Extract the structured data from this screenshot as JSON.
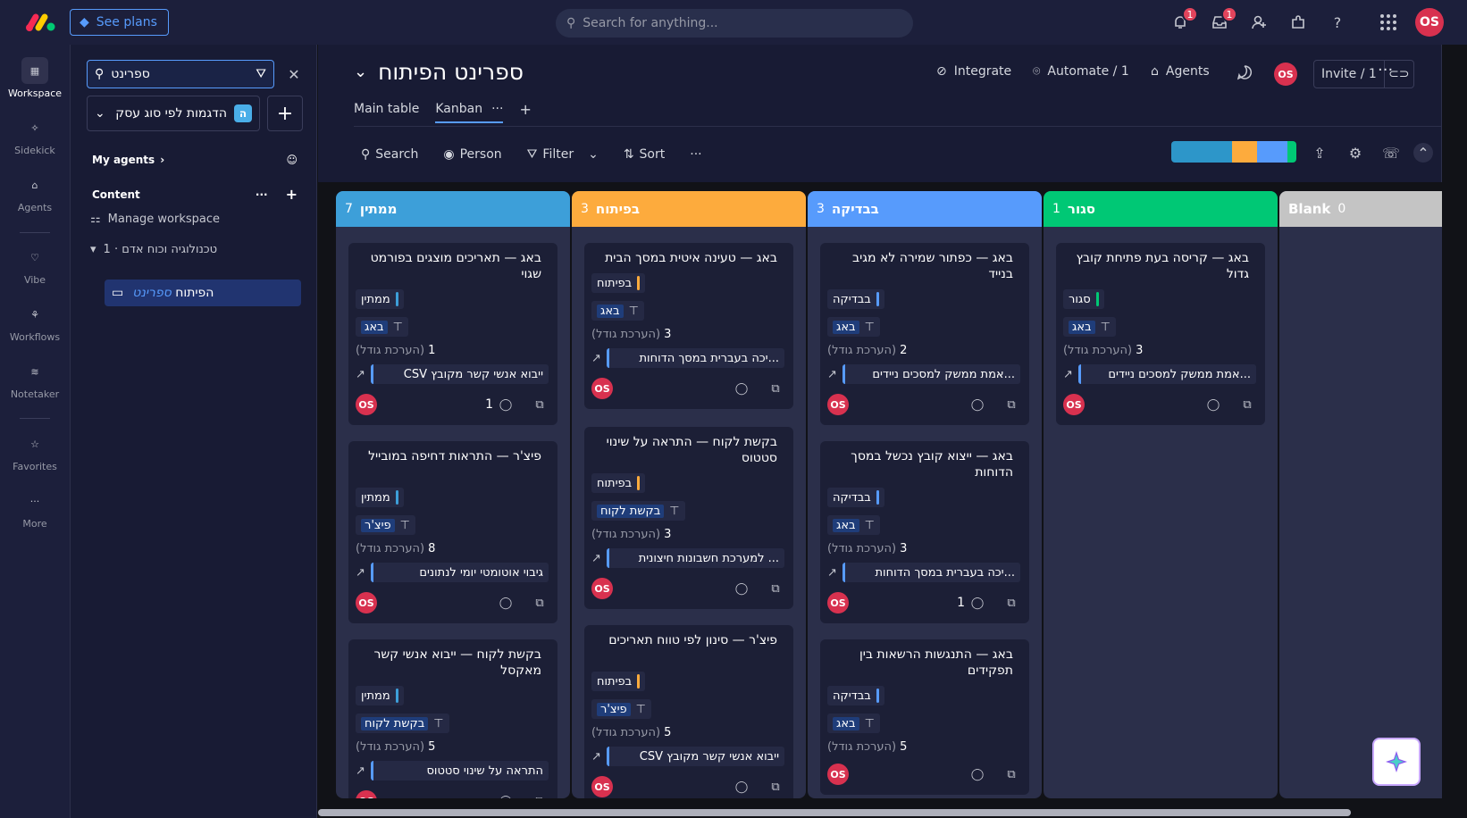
{
  "topbar": {
    "see_plans": "See plans",
    "search_placeholder": "Search for anything...",
    "notifications_badge": "1",
    "inbox_badge": "1",
    "avatar": "OS"
  },
  "rail": [
    {
      "label": "Workspace",
      "icon": "grid-icon"
    },
    {
      "label": "Sidekick",
      "icon": "sparkle-icon"
    },
    {
      "label": "Agents",
      "icon": "agents-icon"
    },
    {
      "label": "Vibe",
      "icon": "heart-icon"
    },
    {
      "label": "Workflows",
      "icon": "workflows-icon"
    },
    {
      "label": "Notetaker",
      "icon": "waveform-icon"
    },
    {
      "label": "Favorites",
      "icon": "star-icon"
    },
    {
      "label": "More",
      "icon": "more-icon"
    }
  ],
  "panel": {
    "search_value": "ספרינט",
    "workspace_chip": "ה",
    "workspace_name": "הדגמות לפי סוג עסק",
    "my_agents": "My agents",
    "content": "Content",
    "manage_workspace": "Manage workspace",
    "folder": "טכנולוגיה וכוח אדם · 1",
    "board_prefix": "ספרינט",
    "board_suffix": "הפיתוח"
  },
  "header": {
    "title": "ספרינט הפיתוח",
    "integrate": "Integrate",
    "automate": "Automate / 1",
    "agents": "Agents",
    "avatar": "OS",
    "invite": "Invite / 1"
  },
  "tabs": {
    "main_table": "Main table",
    "kanban": "Kanban"
  },
  "toolbar": {
    "search": "Search",
    "person": "Person",
    "filter": "Filter",
    "sort": "Sort"
  },
  "colors": {
    "waiting": "#579bfc",
    "dev": "#fdab3d",
    "review": "#579bfc",
    "closed": "#00c875",
    "blank": "#c4c4c4"
  },
  "columns": [
    {
      "title": "ממתין",
      "count": "7",
      "color": "#3d9fd9",
      "cards": [
        {
          "title": "באג — תאריכים מוצגים בפורמט שגוי",
          "status": "ממתין",
          "type": "באג",
          "estimate_label": "(הערכת גודל)",
          "estimate": "1",
          "link": "ייבוא אנשי קשר מקובץ CSV",
          "comments": "1"
        },
        {
          "title": "פיצ'ר — התראות דחיפה במובייל",
          "status": "ממתין",
          "type": "פיצ'ר",
          "estimate_label": "(הערכת גודל)",
          "estimate": "8",
          "link": "גיבוי אוטומטי יומי לנתונים",
          "comments": ""
        },
        {
          "title": "בקשת לקוח — ייבוא אנשי קשר מאקסל",
          "status": "ממתין",
          "type": "בקשת לקוח",
          "estimate_label": "(הערכת גודל)",
          "estimate": "5",
          "link": "התראה על שינוי סטטוס",
          "comments": ""
        }
      ]
    },
    {
      "title": "בפיתוח",
      "count": "3",
      "color": "#fdab3d",
      "cards": [
        {
          "title": "באג — טעינה איטית במסך הבית",
          "status": "בפיתוח",
          "type": "באג",
          "estimate_label": "(הערכת גודל)",
          "estimate": "3",
          "link": "...יכה בעברית במסך הדוחות",
          "comments": ""
        },
        {
          "title": "בקשת לקוח — התראה על שינוי סטטוס",
          "status": "בפיתוח",
          "type": "בקשת לקוח",
          "estimate_label": "(הערכת גודל)",
          "estimate": "3",
          "link": "... למערכת חשבונות חיצונית",
          "comments": ""
        },
        {
          "title": "פיצ'ר — סינון לפי טווח תאריכים",
          "status": "בפיתוח",
          "type": "פיצ'ר",
          "estimate_label": "(הערכת גודל)",
          "estimate": "5",
          "link": "ייבוא אנשי קשר מקובץ CSV",
          "comments": ""
        }
      ]
    },
    {
      "title": "בבדיקה",
      "count": "3",
      "color": "#579bfc",
      "cards": [
        {
          "title": "באג — כפתור שמירה לא מגיב בנייד",
          "status": "בבדיקה",
          "type": "באג",
          "estimate_label": "(הערכת גודל)",
          "estimate": "2",
          "link": "...אמת ממשק למסכים ניידים",
          "comments": ""
        },
        {
          "title": "באג — ייצוא קובץ נכשל במסך הדוחות",
          "status": "בבדיקה",
          "type": "באג",
          "estimate_label": "(הערכת גודל)",
          "estimate": "3",
          "link": "...יכה בעברית במסך הדוחות",
          "comments": "1"
        },
        {
          "title": "באג — התנגשות הרשאות בין תפקידים",
          "status": "בבדיקה",
          "type": "באג",
          "estimate_label": "(הערכת גודל)",
          "estimate": "5",
          "link": "",
          "comments": ""
        }
      ]
    },
    {
      "title": "סגור",
      "count": "1",
      "color": "#00c875",
      "cards": [
        {
          "title": "באג — קריסה בעת פתיחת קובץ גדול",
          "status": "סגור",
          "type": "באג",
          "estimate_label": "(הערכת גודל)",
          "estimate": "3",
          "link": "...אמת ממשק למסכים ניידים",
          "comments": ""
        }
      ]
    },
    {
      "title": "Blank",
      "count": "0",
      "color": "#c4c4c4",
      "cards": []
    }
  ]
}
